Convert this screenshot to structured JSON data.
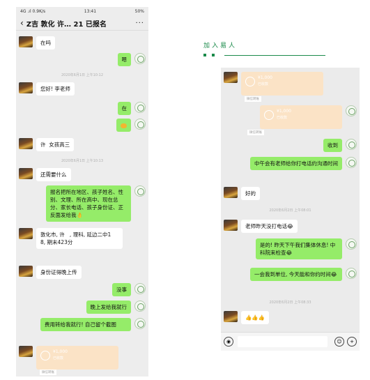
{
  "header": {
    "title": "加入易人"
  },
  "left_phone": {
    "status": {
      "signal": "4G .ıl",
      "speed": "0.9K/s",
      "time": "13:41",
      "battery": "50%"
    },
    "chat_title": "Z吉 敦化 许…   21 已报名",
    "messages": [
      {
        "dir": "in",
        "text": "在吗"
      },
      {
        "dir": "out",
        "text": "嗯"
      },
      {
        "ts": "2020年6月1日 上午10:12"
      },
      {
        "dir": "in",
        "text": "您好! 李老师"
      },
      {
        "dir": "out",
        "text": "在"
      },
      {
        "dir": "out",
        "text": "🤝"
      },
      {
        "dir": "in",
        "text": "许  女孩高三"
      },
      {
        "ts": "2020年6月1日 上午10:13"
      },
      {
        "dir": "in",
        "text": "还需要什么"
      },
      {
        "dir": "out",
        "text": "报名把所在地区、孩子姓名、性别、文理、所在高中、现在总分、家长电话、孩子身份证、正反面发给我👌"
      },
      {
        "dir": "in",
        "text": "敦化市, 许   , 理科, 延边二中1   8, 期末423分"
      },
      {
        "dir": "in",
        "text": "身份证得晚上传"
      },
      {
        "dir": "out",
        "text": "没事"
      },
      {
        "dir": "out",
        "text": "晚上发给我就行"
      },
      {
        "dir": "out",
        "text": "费用转给我就行! 自己留个截图"
      },
      {
        "dir": "in",
        "card": true,
        "amount": "¥1,000",
        "status": "已收款",
        "foot": "微信转账"
      }
    ]
  },
  "right_phone": {
    "messages": [
      {
        "dir": "in",
        "card": true,
        "amount": "¥1,000",
        "status": "已收款",
        "foot": "微信转账"
      },
      {
        "dir": "out",
        "card": true,
        "amount": "¥1,000",
        "status": "已收款",
        "foot": "微信转账"
      },
      {
        "dir": "out",
        "text": "收到"
      },
      {
        "dir": "out",
        "text": "中午会有老师给你打电话约沟通时间"
      },
      {
        "dir": "in",
        "text": "好的"
      },
      {
        "ts": "2020年6月2日 上午08:01"
      },
      {
        "dir": "in",
        "text": "老师昨天没打电话😂"
      },
      {
        "dir": "out",
        "text": "是的! 昨天下午我们集体休息! 中科院来检查😂"
      },
      {
        "dir": "out",
        "text": "一会我到单位, 今天能和你约时间😂"
      },
      {
        "ts": "2020年6月2日 上午08:33"
      },
      {
        "dir": "in",
        "text": "👍👍👍"
      }
    ]
  },
  "input_bar": {
    "voice_icon": "voice-icon",
    "emoji_icon": "emoji-icon",
    "plus_icon": "plus-icon"
  }
}
